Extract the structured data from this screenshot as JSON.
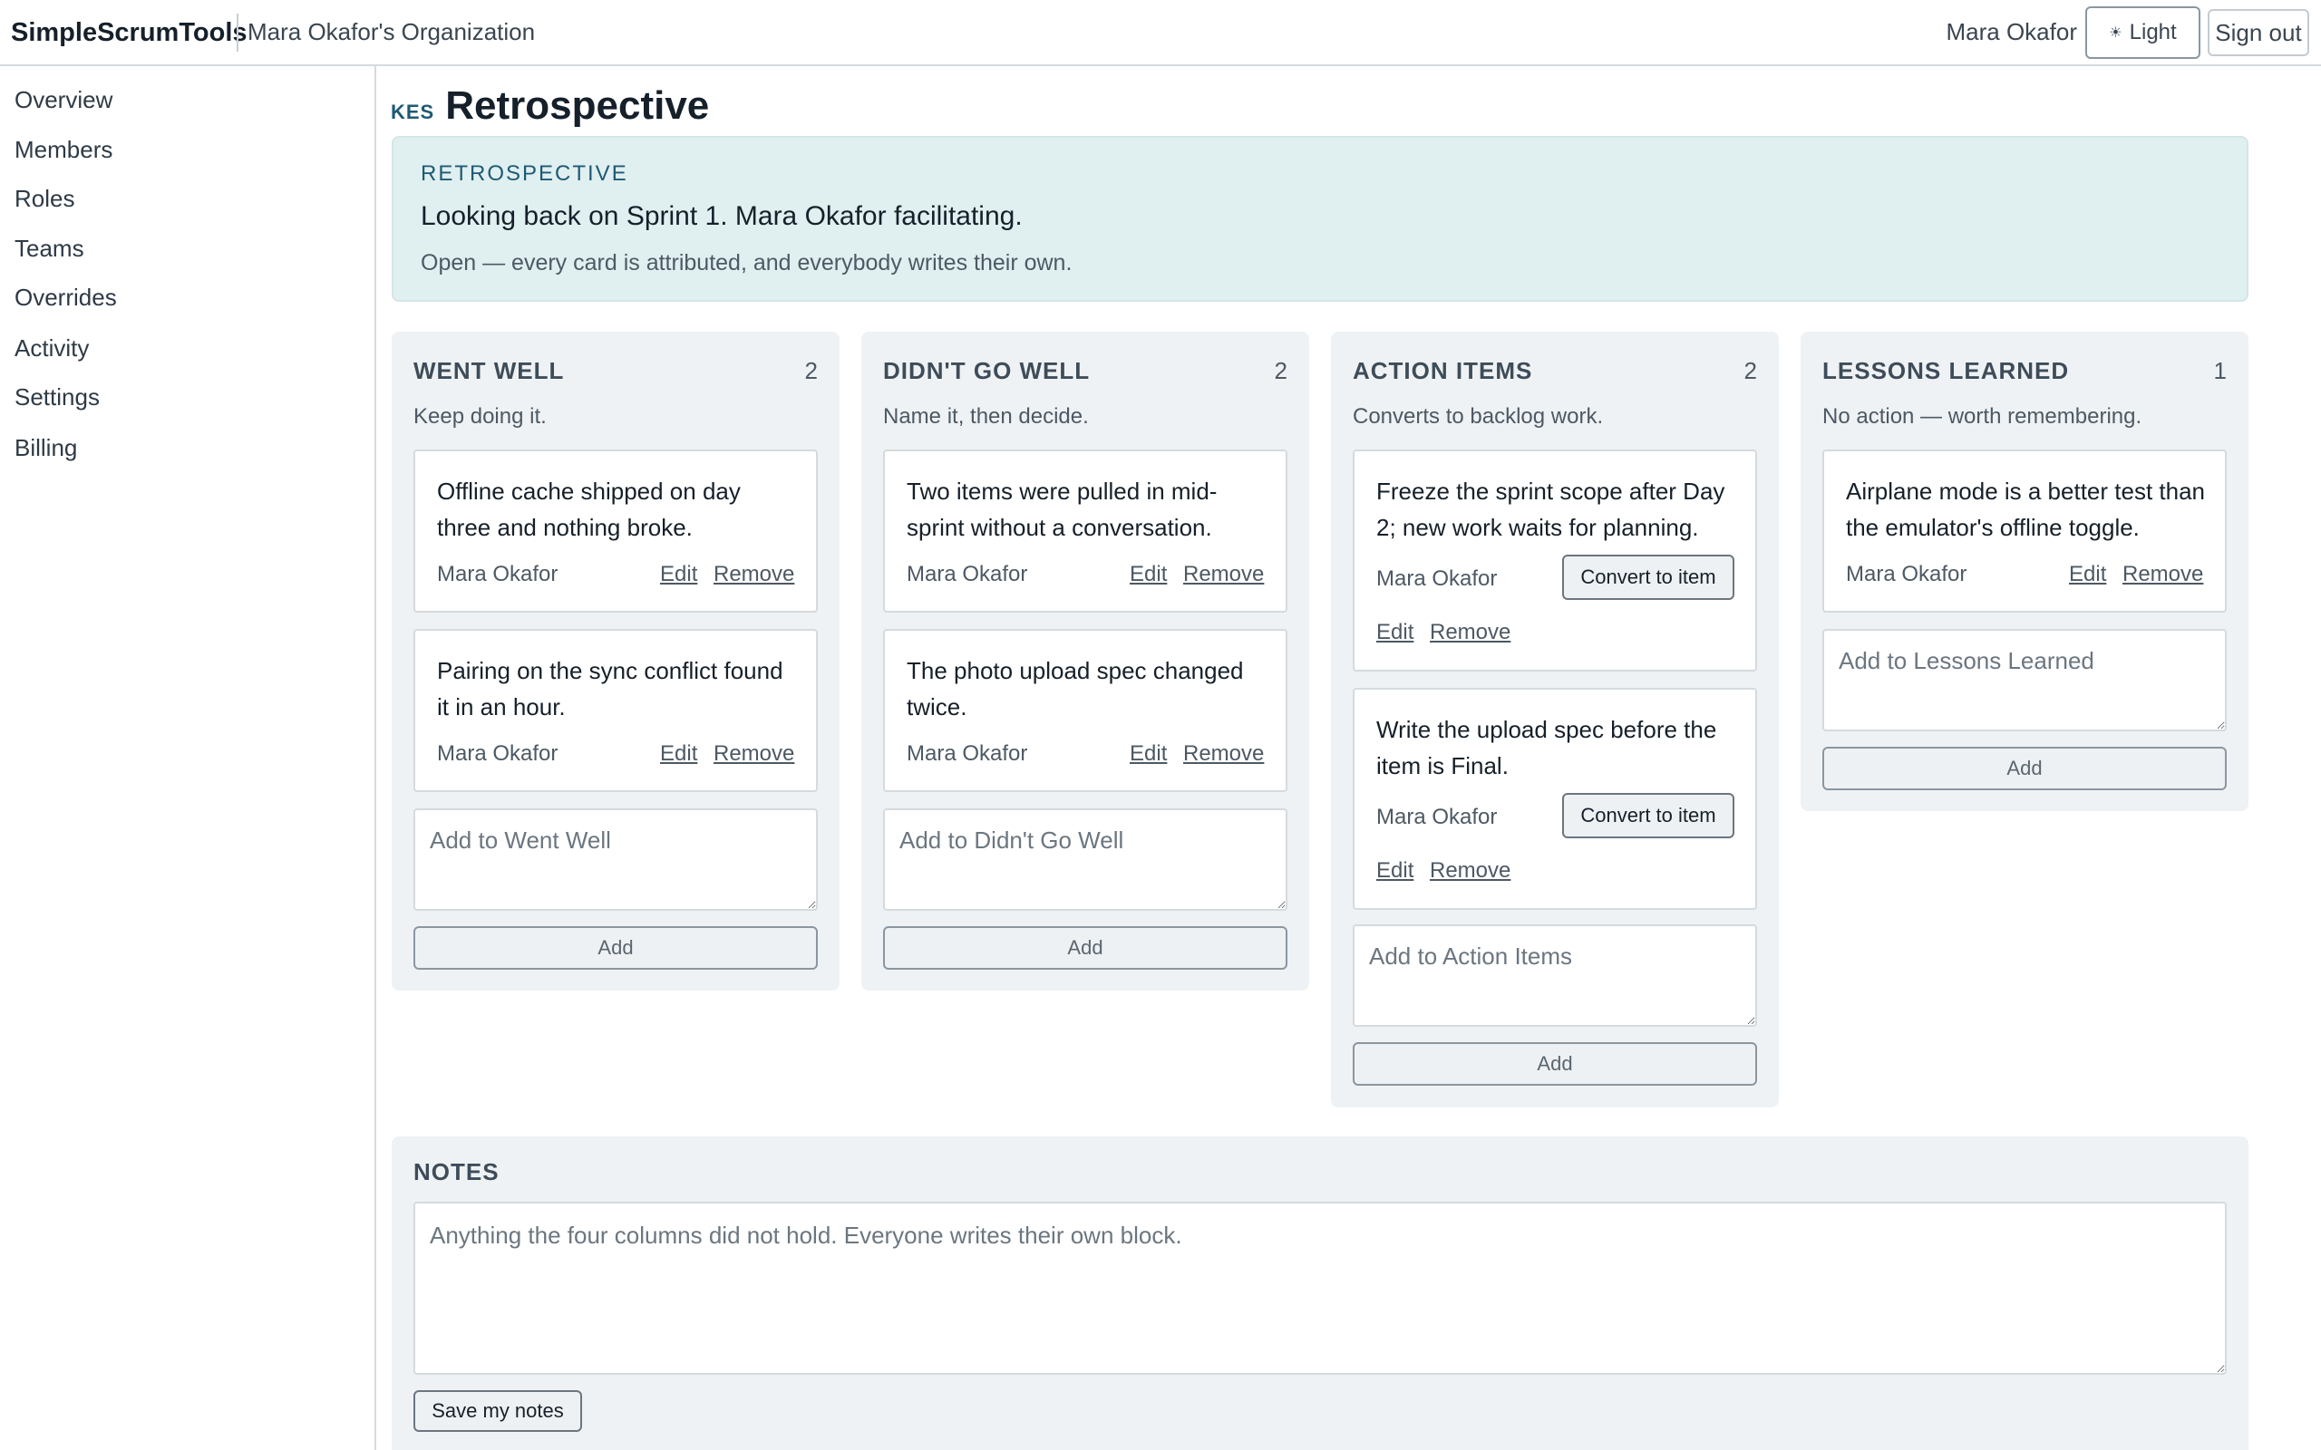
{
  "header": {
    "brand": "SimpleScrumTools",
    "organization": "Mara Okafor's Organization",
    "user": "Mara Okafor",
    "theme_label": "Light",
    "theme_icon": "sun-icon",
    "signout_label": "Sign out"
  },
  "sidebar": {
    "items": [
      {
        "label": "Overview"
      },
      {
        "label": "Members"
      },
      {
        "label": "Roles"
      },
      {
        "label": "Teams"
      },
      {
        "label": "Overrides"
      },
      {
        "label": "Activity"
      },
      {
        "label": "Settings"
      },
      {
        "label": "Billing"
      }
    ]
  },
  "page": {
    "key": "KES",
    "title": "Retrospective"
  },
  "banner": {
    "kicker": "RETROSPECTIVE",
    "headline": "Looking back on Sprint 1. Mara Okafor facilitating.",
    "note": "Open — every card is attributed, and everybody writes their own."
  },
  "card_actions": {
    "edit": "Edit",
    "remove": "Remove",
    "convert": "Convert to item"
  },
  "columns": [
    {
      "title": "WENT WELL",
      "count": "2",
      "subtitle": "Keep doing it.",
      "cards": [
        {
          "text": "Offline cache shipped on day three and nothing broke.",
          "author": "Mara Okafor"
        },
        {
          "text": "Pairing on the sync conflict found it in an hour.",
          "author": "Mara Okafor"
        }
      ],
      "add_placeholder": "Add to Went Well",
      "add_label": "Add"
    },
    {
      "title": "DIDN'T GO WELL",
      "count": "2",
      "subtitle": "Name it, then decide.",
      "cards": [
        {
          "text": "Two items were pulled in mid-sprint without a conversation.",
          "author": "Mara Okafor"
        },
        {
          "text": "The photo upload spec changed twice.",
          "author": "Mara Okafor"
        }
      ],
      "add_placeholder": "Add to Didn't Go Well",
      "add_label": "Add"
    },
    {
      "title": "ACTION ITEMS",
      "count": "2",
      "subtitle": "Converts to backlog work.",
      "cards": [
        {
          "text": "Freeze the sprint scope after Day 2; new work waits for planning.",
          "author": "Mara Okafor"
        },
        {
          "text": "Write the upload spec before the item is Final.",
          "author": "Mara Okafor"
        }
      ],
      "add_placeholder": "Add to Action Items",
      "add_label": "Add"
    },
    {
      "title": "LESSONS LEARNED",
      "count": "1",
      "subtitle": "No action — worth remembering.",
      "cards": [
        {
          "text": "Airplane mode is a better test than the emulator's offline toggle.",
          "author": "Mara Okafor"
        }
      ],
      "add_placeholder": "Add to Lessons Learned",
      "add_label": "Add"
    }
  ],
  "notes": {
    "title": "NOTES",
    "placeholder": "Anything the four columns did not hold. Everyone writes their own block.",
    "save_label": "Save my notes"
  }
}
